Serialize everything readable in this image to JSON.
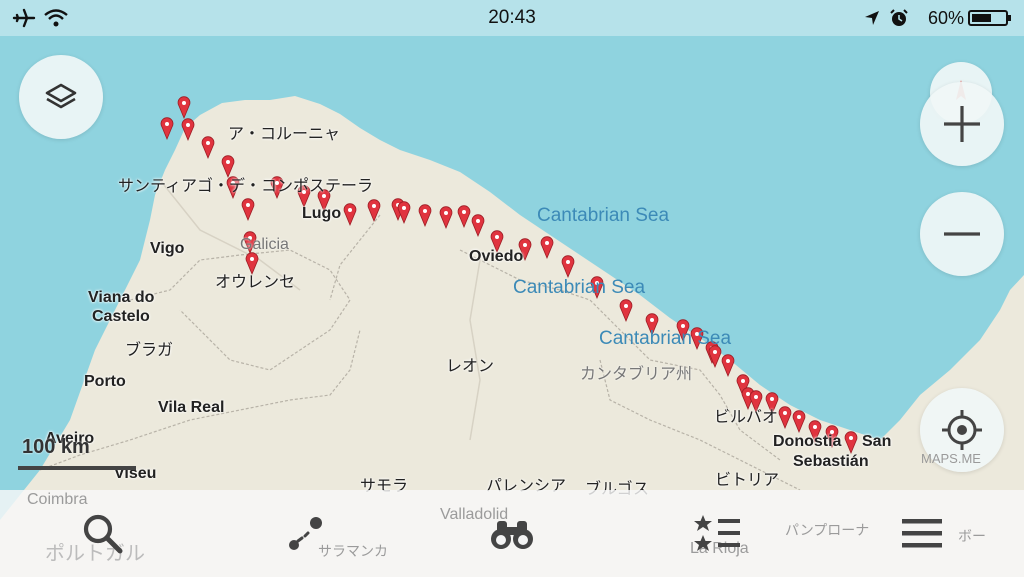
{
  "status_bar": {
    "time": "20:43",
    "battery_percent": "60%",
    "battery_level": 0.6,
    "icons": [
      "airplane-icon",
      "wifi-icon",
      "location-arrow-icon",
      "alarm-icon",
      "battery-icon"
    ]
  },
  "map": {
    "cities": {
      "a_coruna": "ア・コルーニャ",
      "santiago": "サンティアゴ・デ・コンポステーラ",
      "lugo": "Lugo",
      "vigo": "Vigo",
      "galicia": "Galicia",
      "ourense": "オウレンセ",
      "viana_1": "Viana do",
      "viana_2": "Castelo",
      "braga": "ブラガ",
      "porto": "Porto",
      "vila_real": "Vila Real",
      "aveiro": "Aveiro",
      "viseu": "Viseu",
      "coimbra": "Coimbra",
      "portugal": "ポルトガル",
      "oviedo": "Oviedo",
      "leon": "レオン",
      "cantabria": "カンタブリア州",
      "bilbao": "ビルバオ",
      "donostia_1": "Donostia",
      "san": "San",
      "donostia_2": "Sebastián",
      "vitoria": "ビトリア",
      "zamora": "サモラ",
      "palencia": "パレンシア",
      "burgos": "ブルゴス",
      "valladolid": "Valladolid",
      "salamanca": "サラマンカ",
      "la_rioja": "La Rioja",
      "pamplona": "パンプローナ",
      "bo": "ボー"
    },
    "seas": [
      "Cantabrian Sea",
      "Cantabrian Sea",
      "Cantabrian Sea"
    ],
    "scale": "100 km",
    "watermark": "MAPS.ME",
    "pin_color": "#e0343f",
    "land_color": "#ece9dc",
    "water_color": "#8fd3df"
  },
  "controls": {
    "icons": [
      "layers-icon",
      "compass-icon",
      "zoom-in-icon",
      "zoom-out-icon",
      "my-location-icon"
    ]
  },
  "bottom_bar": {
    "icons": [
      "search-icon",
      "route-icon",
      "discover-icon",
      "bookmarks-icon",
      "menu-icon"
    ]
  }
}
